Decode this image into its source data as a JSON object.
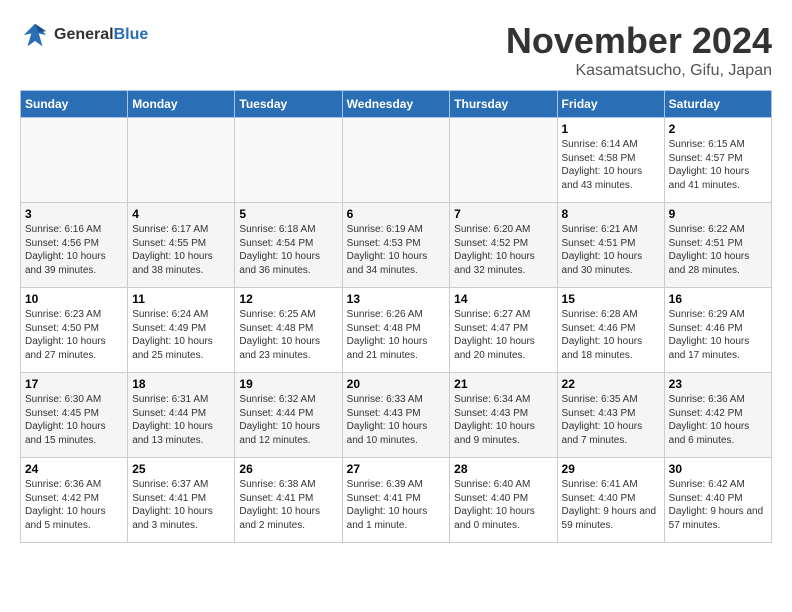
{
  "header": {
    "logo_general": "General",
    "logo_blue": "Blue",
    "month_title": "November 2024",
    "location": "Kasamatsucho, Gifu, Japan"
  },
  "weekdays": [
    "Sunday",
    "Monday",
    "Tuesday",
    "Wednesday",
    "Thursday",
    "Friday",
    "Saturday"
  ],
  "weeks": [
    [
      {
        "day": "",
        "sunrise": "",
        "sunset": "",
        "daylight": ""
      },
      {
        "day": "",
        "sunrise": "",
        "sunset": "",
        "daylight": ""
      },
      {
        "day": "",
        "sunrise": "",
        "sunset": "",
        "daylight": ""
      },
      {
        "day": "",
        "sunrise": "",
        "sunset": "",
        "daylight": ""
      },
      {
        "day": "",
        "sunrise": "",
        "sunset": "",
        "daylight": ""
      },
      {
        "day": "1",
        "sunrise": "Sunrise: 6:14 AM",
        "sunset": "Sunset: 4:58 PM",
        "daylight": "Daylight: 10 hours and 43 minutes."
      },
      {
        "day": "2",
        "sunrise": "Sunrise: 6:15 AM",
        "sunset": "Sunset: 4:57 PM",
        "daylight": "Daylight: 10 hours and 41 minutes."
      }
    ],
    [
      {
        "day": "3",
        "sunrise": "Sunrise: 6:16 AM",
        "sunset": "Sunset: 4:56 PM",
        "daylight": "Daylight: 10 hours and 39 minutes."
      },
      {
        "day": "4",
        "sunrise": "Sunrise: 6:17 AM",
        "sunset": "Sunset: 4:55 PM",
        "daylight": "Daylight: 10 hours and 38 minutes."
      },
      {
        "day": "5",
        "sunrise": "Sunrise: 6:18 AM",
        "sunset": "Sunset: 4:54 PM",
        "daylight": "Daylight: 10 hours and 36 minutes."
      },
      {
        "day": "6",
        "sunrise": "Sunrise: 6:19 AM",
        "sunset": "Sunset: 4:53 PM",
        "daylight": "Daylight: 10 hours and 34 minutes."
      },
      {
        "day": "7",
        "sunrise": "Sunrise: 6:20 AM",
        "sunset": "Sunset: 4:52 PM",
        "daylight": "Daylight: 10 hours and 32 minutes."
      },
      {
        "day": "8",
        "sunrise": "Sunrise: 6:21 AM",
        "sunset": "Sunset: 4:51 PM",
        "daylight": "Daylight: 10 hours and 30 minutes."
      },
      {
        "day": "9",
        "sunrise": "Sunrise: 6:22 AM",
        "sunset": "Sunset: 4:51 PM",
        "daylight": "Daylight: 10 hours and 28 minutes."
      }
    ],
    [
      {
        "day": "10",
        "sunrise": "Sunrise: 6:23 AM",
        "sunset": "Sunset: 4:50 PM",
        "daylight": "Daylight: 10 hours and 27 minutes."
      },
      {
        "day": "11",
        "sunrise": "Sunrise: 6:24 AM",
        "sunset": "Sunset: 4:49 PM",
        "daylight": "Daylight: 10 hours and 25 minutes."
      },
      {
        "day": "12",
        "sunrise": "Sunrise: 6:25 AM",
        "sunset": "Sunset: 4:48 PM",
        "daylight": "Daylight: 10 hours and 23 minutes."
      },
      {
        "day": "13",
        "sunrise": "Sunrise: 6:26 AM",
        "sunset": "Sunset: 4:48 PM",
        "daylight": "Daylight: 10 hours and 21 minutes."
      },
      {
        "day": "14",
        "sunrise": "Sunrise: 6:27 AM",
        "sunset": "Sunset: 4:47 PM",
        "daylight": "Daylight: 10 hours and 20 minutes."
      },
      {
        "day": "15",
        "sunrise": "Sunrise: 6:28 AM",
        "sunset": "Sunset: 4:46 PM",
        "daylight": "Daylight: 10 hours and 18 minutes."
      },
      {
        "day": "16",
        "sunrise": "Sunrise: 6:29 AM",
        "sunset": "Sunset: 4:46 PM",
        "daylight": "Daylight: 10 hours and 17 minutes."
      }
    ],
    [
      {
        "day": "17",
        "sunrise": "Sunrise: 6:30 AM",
        "sunset": "Sunset: 4:45 PM",
        "daylight": "Daylight: 10 hours and 15 minutes."
      },
      {
        "day": "18",
        "sunrise": "Sunrise: 6:31 AM",
        "sunset": "Sunset: 4:44 PM",
        "daylight": "Daylight: 10 hours and 13 minutes."
      },
      {
        "day": "19",
        "sunrise": "Sunrise: 6:32 AM",
        "sunset": "Sunset: 4:44 PM",
        "daylight": "Daylight: 10 hours and 12 minutes."
      },
      {
        "day": "20",
        "sunrise": "Sunrise: 6:33 AM",
        "sunset": "Sunset: 4:43 PM",
        "daylight": "Daylight: 10 hours and 10 minutes."
      },
      {
        "day": "21",
        "sunrise": "Sunrise: 6:34 AM",
        "sunset": "Sunset: 4:43 PM",
        "daylight": "Daylight: 10 hours and 9 minutes."
      },
      {
        "day": "22",
        "sunrise": "Sunrise: 6:35 AM",
        "sunset": "Sunset: 4:43 PM",
        "daylight": "Daylight: 10 hours and 7 minutes."
      },
      {
        "day": "23",
        "sunrise": "Sunrise: 6:36 AM",
        "sunset": "Sunset: 4:42 PM",
        "daylight": "Daylight: 10 hours and 6 minutes."
      }
    ],
    [
      {
        "day": "24",
        "sunrise": "Sunrise: 6:36 AM",
        "sunset": "Sunset: 4:42 PM",
        "daylight": "Daylight: 10 hours and 5 minutes."
      },
      {
        "day": "25",
        "sunrise": "Sunrise: 6:37 AM",
        "sunset": "Sunset: 4:41 PM",
        "daylight": "Daylight: 10 hours and 3 minutes."
      },
      {
        "day": "26",
        "sunrise": "Sunrise: 6:38 AM",
        "sunset": "Sunset: 4:41 PM",
        "daylight": "Daylight: 10 hours and 2 minutes."
      },
      {
        "day": "27",
        "sunrise": "Sunrise: 6:39 AM",
        "sunset": "Sunset: 4:41 PM",
        "daylight": "Daylight: 10 hours and 1 minute."
      },
      {
        "day": "28",
        "sunrise": "Sunrise: 6:40 AM",
        "sunset": "Sunset: 4:40 PM",
        "daylight": "Daylight: 10 hours and 0 minutes."
      },
      {
        "day": "29",
        "sunrise": "Sunrise: 6:41 AM",
        "sunset": "Sunset: 4:40 PM",
        "daylight": "Daylight: 9 hours and 59 minutes."
      },
      {
        "day": "30",
        "sunrise": "Sunrise: 6:42 AM",
        "sunset": "Sunset: 4:40 PM",
        "daylight": "Daylight: 9 hours and 57 minutes."
      }
    ]
  ]
}
